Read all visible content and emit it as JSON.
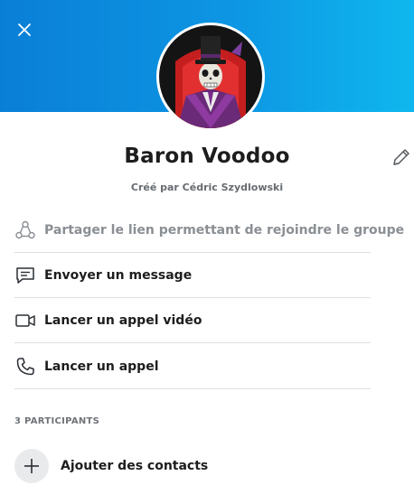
{
  "header": {
    "close_icon": "close-icon",
    "avatar_icon": "group-avatar"
  },
  "group": {
    "title": "Baron Voodoo",
    "created_by": "Créé par Cédric Szydlowski",
    "edit_icon": "pencil-icon"
  },
  "actions": [
    {
      "label": "Partager le lien permettant de rejoindre le groupe",
      "icon": "share-icon",
      "enabled": false
    },
    {
      "label": "Envoyer un message",
      "icon": "message-icon",
      "enabled": true
    },
    {
      "label": "Lancer un appel vidéo",
      "icon": "video-icon",
      "enabled": true
    },
    {
      "label": "Lancer un appel",
      "icon": "phone-icon",
      "enabled": true
    }
  ],
  "participants": {
    "header": "3 PARTICIPANTS",
    "add_label": "Ajouter des contacts",
    "add_icon": "plus-icon"
  },
  "colors": {
    "banner_start": "#0a7fd6",
    "banner_end": "#0fb7ee",
    "text_primary": "#1d1d1d",
    "text_muted": "#8a8f94"
  }
}
